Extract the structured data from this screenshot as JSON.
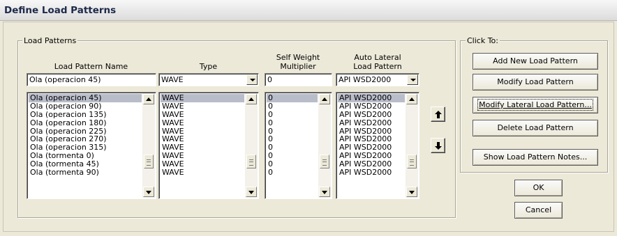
{
  "window": {
    "title": "Define Load Patterns"
  },
  "load_patterns_group": {
    "legend": "Load Patterns",
    "headers": {
      "name": "Load Pattern Name",
      "type": "Type",
      "self_weight_line1": "Self Weight",
      "self_weight_line2": "Multiplier",
      "auto_lateral_line1": "Auto Lateral",
      "auto_lateral_line2": "Load Pattern"
    },
    "inputs": {
      "name": "Ola (operacion 45)",
      "type": "WAVE",
      "self_weight": "0",
      "auto_lateral": "API WSD2000"
    },
    "rows": [
      {
        "name": "Ola (operacion 45)",
        "type": "WAVE",
        "multiplier": "0",
        "auto_lateral": "API WSD2000"
      },
      {
        "name": "Ola (operacion 90)",
        "type": "WAVE",
        "multiplier": "0",
        "auto_lateral": "API WSD2000"
      },
      {
        "name": "Ola (operacion 135)",
        "type": "WAVE",
        "multiplier": "0",
        "auto_lateral": "API WSD2000"
      },
      {
        "name": "Ola (operacion 180)",
        "type": "WAVE",
        "multiplier": "0",
        "auto_lateral": "API WSD2000"
      },
      {
        "name": "Ola (operacion 225)",
        "type": "WAVE",
        "multiplier": "0",
        "auto_lateral": "API WSD2000"
      },
      {
        "name": "Ola (operacion 270)",
        "type": "WAVE",
        "multiplier": "0",
        "auto_lateral": "API WSD2000"
      },
      {
        "name": "Ola (operacion 315)",
        "type": "WAVE",
        "multiplier": "0",
        "auto_lateral": "API WSD2000"
      },
      {
        "name": "Ola (tormenta 0)",
        "type": "WAVE",
        "multiplier": "0",
        "auto_lateral": "API WSD2000"
      },
      {
        "name": "Ola (tormenta 45)",
        "type": "WAVE",
        "multiplier": "0",
        "auto_lateral": "API WSD2000"
      },
      {
        "name": "Ola (tormenta 90)",
        "type": "WAVE",
        "multiplier": "0",
        "auto_lateral": "API WSD2000"
      }
    ],
    "selected_index": 0,
    "icons": {
      "move_up": "arrow-up-icon",
      "move_down": "arrow-down-icon"
    }
  },
  "click_to_group": {
    "legend": "Click To:",
    "buttons": {
      "add": "Add New Load Pattern",
      "modify": "Modify Load Pattern",
      "modify_lateral": "Modify Lateral Load Pattern...",
      "delete": "Delete Load Pattern",
      "notes": "Show Load Pattern Notes..."
    }
  },
  "dialog_buttons": {
    "ok": "OK",
    "cancel": "Cancel"
  },
  "colors": {
    "selection": "#b9bcc9",
    "background": "#ece9d8",
    "title_text": "#1d2a4a"
  }
}
